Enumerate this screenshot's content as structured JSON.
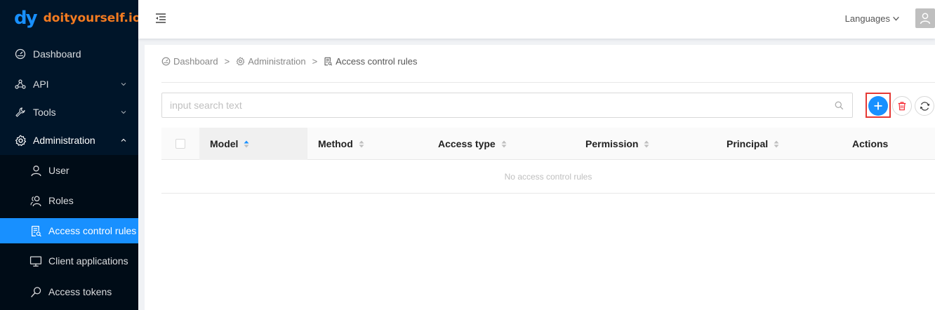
{
  "app": {
    "logo_mark": "dy",
    "logo_text": "doityourself.io"
  },
  "sidebar": {
    "items": [
      {
        "label": "Dashboard",
        "icon": "dashboard-icon"
      },
      {
        "label": "API",
        "icon": "api-icon"
      },
      {
        "label": "Tools",
        "icon": "tool-icon"
      },
      {
        "label": "Administration",
        "icon": "gear-icon"
      }
    ],
    "subitems": [
      {
        "label": "User",
        "icon": "user-icon"
      },
      {
        "label": "Roles",
        "icon": "roles-icon"
      },
      {
        "label": "Access control rules",
        "icon": "audit-icon",
        "selected": true
      },
      {
        "label": "Client applications",
        "icon": "desktop-icon"
      },
      {
        "label": "Access tokens",
        "icon": "key-search-icon"
      }
    ]
  },
  "header": {
    "languages_label": "Languages"
  },
  "breadcrumb": [
    {
      "label": "Dashboard",
      "icon": "dashboard-icon"
    },
    {
      "label": "Administration",
      "icon": "gear-icon"
    },
    {
      "label": "Access control rules",
      "icon": "audit-icon"
    }
  ],
  "breadcrumb_separator": ">",
  "search": {
    "placeholder": "input search text",
    "value": ""
  },
  "table": {
    "columns": [
      "Model",
      "Method",
      "Access type",
      "Permission",
      "Principal",
      "Actions"
    ],
    "empty_text": "No access control rules"
  },
  "colors": {
    "sidebar_bg": "#001529",
    "submenu_bg": "#000c17",
    "accent": "#1890ff",
    "logo_orange": "#f47b20",
    "delete_red": "#f5222d",
    "highlight_red": "#e53935"
  }
}
